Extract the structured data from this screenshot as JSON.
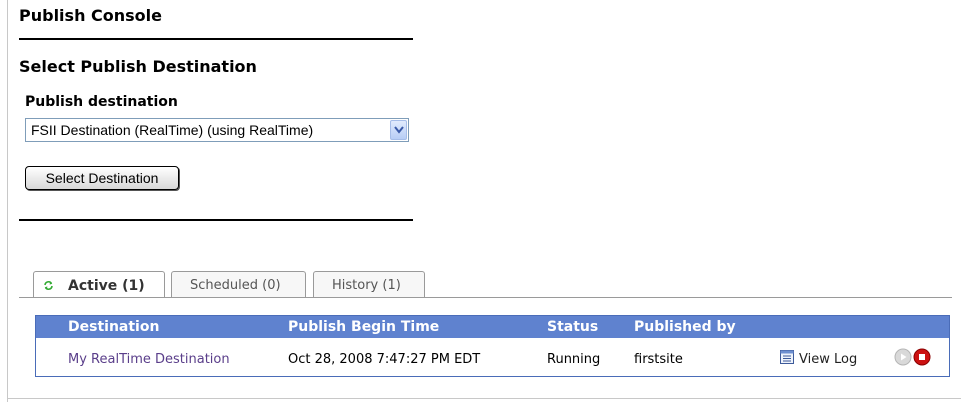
{
  "page": {
    "title": "Publish Console"
  },
  "selection": {
    "heading": "Select Publish Destination",
    "field_label": "Publish destination",
    "selected_value": "FSII Destination (RealTime) (using RealTime)",
    "button_label": "Select Destination"
  },
  "tabs": [
    {
      "label": "Active (1)",
      "icon": "refresh-icon",
      "active": true
    },
    {
      "label": "Scheduled (0)",
      "active": false
    },
    {
      "label": "History (1)",
      "active": false
    }
  ],
  "table": {
    "headers": [
      "Destination",
      "Publish Begin Time",
      "Status",
      "Published by"
    ],
    "rows": [
      {
        "destination": "My RealTime Destination",
        "begin_time": "Oct 28, 2008 7:47:27 PM EDT",
        "status": "Running",
        "published_by": "firstsite",
        "log_label": "View Log"
      }
    ]
  },
  "colors": {
    "table_header": "#5f82cf",
    "link": "#5a3e8a",
    "stop_button": "#cc1111",
    "tab_icon": "#33aa33"
  }
}
